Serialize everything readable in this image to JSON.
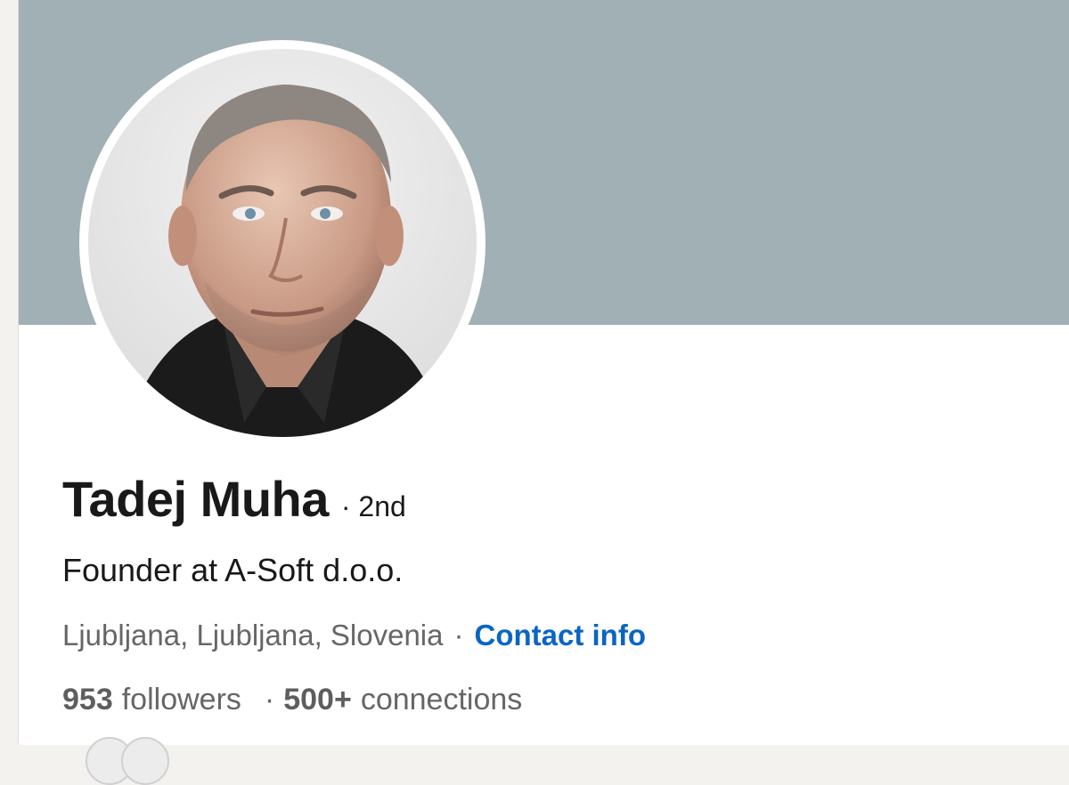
{
  "profile": {
    "name": "Tadej Muha",
    "degree": "· 2nd",
    "headline": "Founder at A-Soft d.o.o.",
    "location": "Ljubljana, Ljubljana, Slovenia",
    "location_separator": "·",
    "contact_info_label": "Contact info",
    "followers_count": "953",
    "followers_label": "followers",
    "connections_separator": "·",
    "connections_count": "500+",
    "connections_label": "connections"
  },
  "colors": {
    "banner": "#a1b0b4",
    "link": "#0a66c2",
    "text_primary": "#191919",
    "text_secondary": "#666666"
  },
  "icons": {
    "avatar": "profile-photo"
  }
}
